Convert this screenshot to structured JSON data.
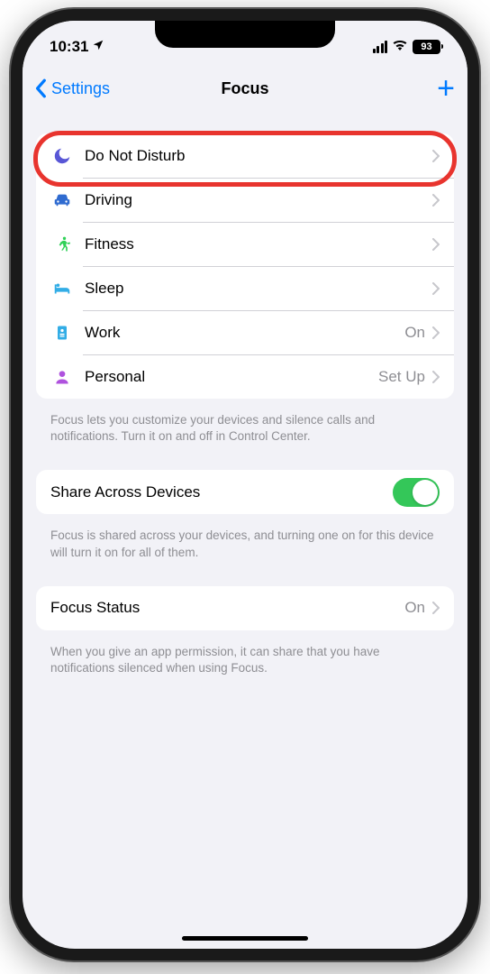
{
  "status": {
    "time": "10:31",
    "battery": "93"
  },
  "nav": {
    "back": "Settings",
    "title": "Focus"
  },
  "focus_modes": [
    {
      "id": "dnd",
      "label": "Do Not Disturb",
      "detail": "",
      "icon": "moon",
      "color": "#5856d6"
    },
    {
      "id": "driving",
      "label": "Driving",
      "detail": "",
      "icon": "car",
      "color": "#2f6bd0"
    },
    {
      "id": "fitness",
      "label": "Fitness",
      "detail": "",
      "icon": "runner",
      "color": "#30d158"
    },
    {
      "id": "sleep",
      "label": "Sleep",
      "detail": "",
      "icon": "bed",
      "color": "#32ade6"
    },
    {
      "id": "work",
      "label": "Work",
      "detail": "On",
      "icon": "badge",
      "color": "#32ade6"
    },
    {
      "id": "personal",
      "label": "Personal",
      "detail": "Set Up",
      "icon": "person",
      "color": "#af52de"
    }
  ],
  "footer_modes": "Focus lets you customize your devices and silence calls and notifications. Turn it on and off in Control Center.",
  "share": {
    "label": "Share Across Devices",
    "on": true,
    "footer": "Focus is shared across your devices, and turning one on for this device will turn it on for all of them."
  },
  "status_row": {
    "label": "Focus Status",
    "detail": "On",
    "footer": "When you give an app permission, it can share that you have notifications silenced when using Focus."
  }
}
